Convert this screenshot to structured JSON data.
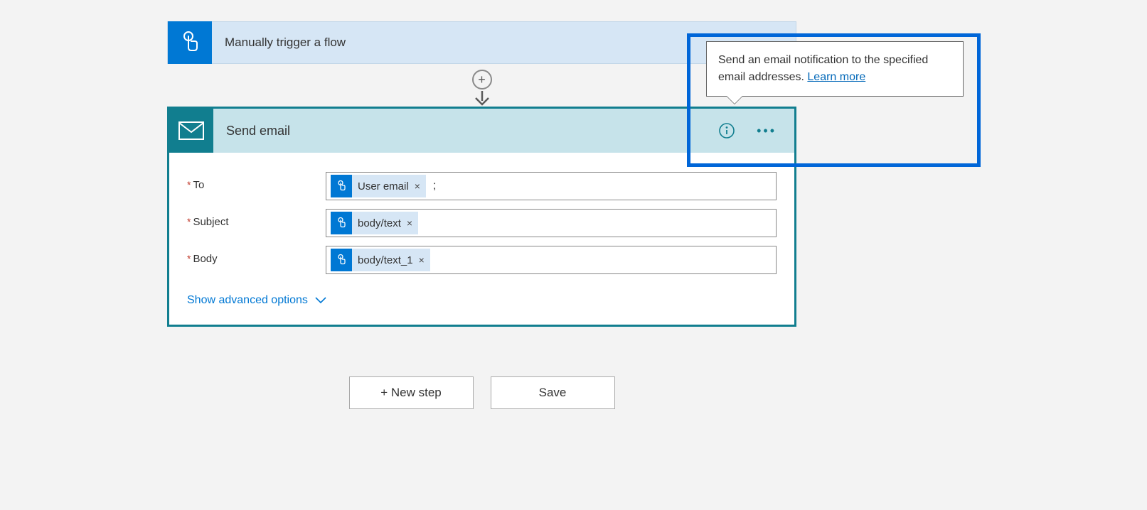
{
  "trigger": {
    "title": "Manually trigger a flow"
  },
  "action": {
    "title": "Send email",
    "fields": {
      "to": {
        "label": "To",
        "token": "User email",
        "trailing": ";"
      },
      "subject": {
        "label": "Subject",
        "token": "body/text"
      },
      "body": {
        "label": "Body",
        "token": "body/text_1"
      }
    },
    "advanced_label": "Show advanced options"
  },
  "buttons": {
    "new_step": "+ New step",
    "save": "Save"
  },
  "tooltip": {
    "text": "Send an email notification to the specified email addresses. ",
    "link": "Learn more"
  }
}
